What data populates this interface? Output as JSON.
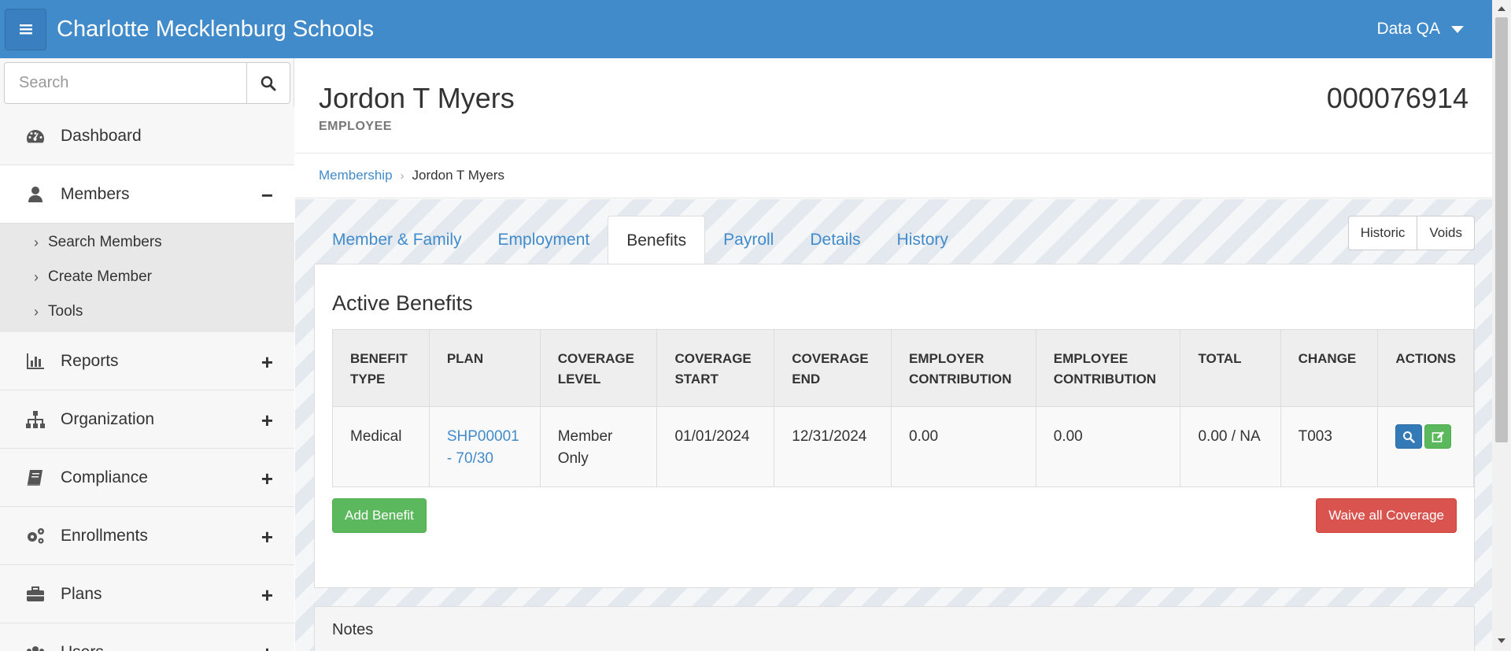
{
  "app": {
    "title": "Charlotte Mecklenburg Schools",
    "user": "Data QA"
  },
  "sidebar": {
    "search_placeholder": "Search",
    "items": [
      {
        "label": "Dashboard",
        "icon": "dashboard-icon",
        "toggle": ""
      },
      {
        "label": "Members",
        "icon": "user-icon",
        "toggle": "−"
      },
      {
        "label": "Reports",
        "icon": "bar-chart-icon",
        "toggle": "+"
      },
      {
        "label": "Organization",
        "icon": "sitemap-icon",
        "toggle": "+"
      },
      {
        "label": "Compliance",
        "icon": "book-icon",
        "toggle": "+"
      },
      {
        "label": "Enrollments",
        "icon": "cogs-icon",
        "toggle": "+"
      },
      {
        "label": "Plans",
        "icon": "briefcase-icon",
        "toggle": "+"
      },
      {
        "label": "Users",
        "icon": "users-icon",
        "toggle": "+"
      }
    ],
    "subitems": [
      "Search Members",
      "Create Member",
      "Tools"
    ]
  },
  "member": {
    "name": "Jordon T Myers",
    "role": "EMPLOYEE",
    "id": "000076914"
  },
  "breadcrumb": {
    "parent": "Membership",
    "current": "Jordon T Myers"
  },
  "tabs": [
    "Member & Family",
    "Employment",
    "Benefits",
    "Payroll",
    "Details",
    "History"
  ],
  "active_tab": "Benefits",
  "view_buttons": {
    "historic": "Historic",
    "voids": "Voids"
  },
  "benefits": {
    "title": "Active Benefits",
    "headers": [
      {
        "l1": "BENEFIT",
        "l2": "TYPE"
      },
      {
        "l1": "PLAN",
        "l2": ""
      },
      {
        "l1": "COVERAGE",
        "l2": "LEVEL"
      },
      {
        "l1": "COVERAGE",
        "l2": "START"
      },
      {
        "l1": "COVERAGE",
        "l2": "END"
      },
      {
        "l1": "EMPLOYER",
        "l2": "CONTRIBUTION"
      },
      {
        "l1": "EMPLOYEE",
        "l2": "CONTRIBUTION"
      },
      {
        "l1": "TOTAL",
        "l2": ""
      },
      {
        "l1": "CHANGE",
        "l2": ""
      },
      {
        "l1": "ACTIONS",
        "l2": ""
      }
    ],
    "rows": [
      {
        "type": "Medical",
        "plan_l1": "SHP00001",
        "plan_l2": "- 70/30",
        "level_l1": "Member",
        "level_l2": "Only",
        "start": "01/01/2024",
        "end": "12/31/2024",
        "employer": "0.00",
        "employee": "0.00",
        "total": "0.00 / NA",
        "change": "T003"
      }
    ],
    "add_label": "Add Benefit",
    "waive_label": "Waive all Coverage"
  },
  "notes": {
    "title": "Notes"
  },
  "colors": {
    "primary": "#428bca",
    "success": "#5cb85c",
    "danger": "#d9534f"
  }
}
